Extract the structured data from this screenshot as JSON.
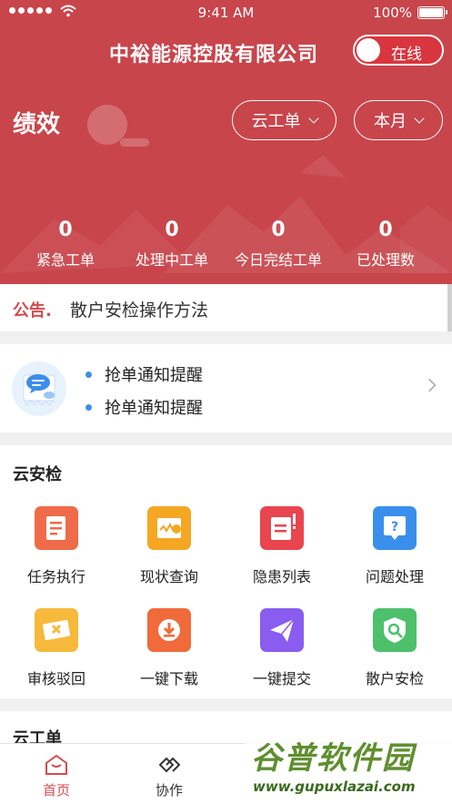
{
  "status_bar": {
    "time": "9:41 AM",
    "battery": "100%"
  },
  "header": {
    "company": "中裕能源控股有限公司",
    "online_label": "在线",
    "section_title": "绩效",
    "type_filter": "云工单",
    "period_filter": "本月",
    "stats": [
      {
        "value": "0",
        "label": "紧急工单"
      },
      {
        "value": "0",
        "label": "处理中工单"
      },
      {
        "value": "0",
        "label": "今日完结工单"
      },
      {
        "value": "0",
        "label": "已处理数"
      }
    ]
  },
  "announcement": {
    "tag": "公告.",
    "text": "散户安检操作方法"
  },
  "notices": [
    "抢单通知提醒",
    "抢单通知提醒"
  ],
  "cloud_inspection": {
    "title": "云安检",
    "items": [
      {
        "label": "任务执行",
        "icon": "task-icon",
        "color": "#ef6b4a"
      },
      {
        "label": "现状查询",
        "icon": "status-query-icon",
        "color": "#f5a623"
      },
      {
        "label": "隐患列表",
        "icon": "hazard-list-icon",
        "color": "#e8454f"
      },
      {
        "label": "问题处理",
        "icon": "question-icon",
        "color": "#3b8fec"
      },
      {
        "label": "审核驳回",
        "icon": "reject-icon",
        "color": "#f6b93b"
      },
      {
        "label": "一键下载",
        "icon": "download-icon",
        "color": "#f06a3a"
      },
      {
        "label": "一键提交",
        "icon": "submit-icon",
        "color": "#8a5cf0"
      },
      {
        "label": "散户安检",
        "icon": "inspect-icon",
        "color": "#4cc06a"
      }
    ]
  },
  "cloud_workorder": {
    "title": "云工单"
  },
  "tabbar": {
    "home": "首页",
    "collab": "协作"
  },
  "watermark": {
    "brand": "谷普软件园",
    "url": "www.gupuxlazai.com"
  },
  "colors": {
    "primary": "#c8454b",
    "accent": "#d44a4f"
  }
}
